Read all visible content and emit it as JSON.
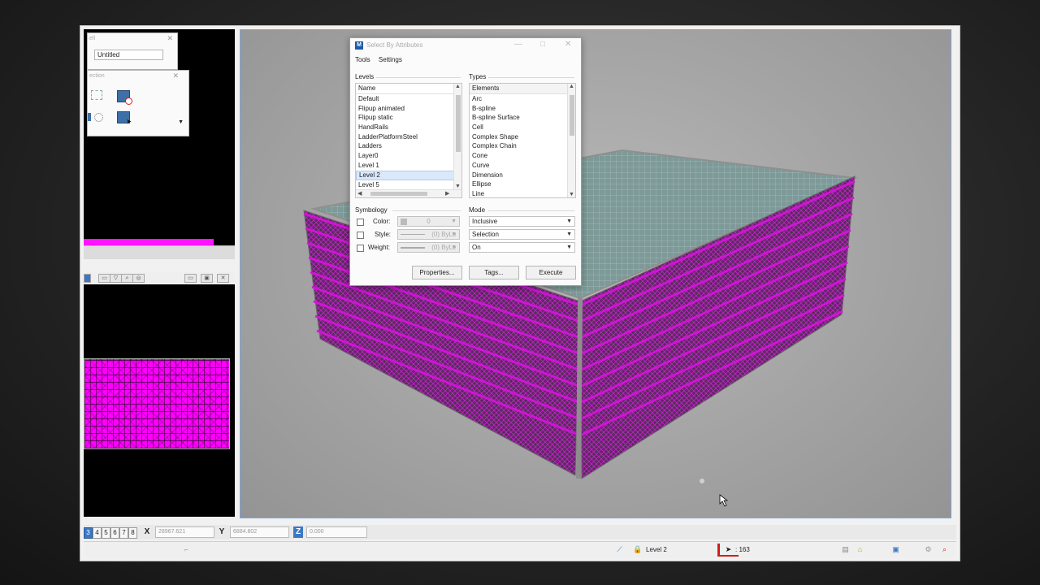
{
  "left_panel": {
    "untitled_value": "Untitled",
    "panel1_partial_title": "ell",
    "panel2_partial_title": "ection"
  },
  "dialog": {
    "title": "Select By Attributes",
    "menu": [
      "Tools",
      "Settings"
    ],
    "levels_group": "Levels",
    "levels_header": "Name",
    "levels": [
      "Default",
      "Flipup animated",
      "Flipup static",
      "HandRails",
      "LadderPlatformSteel",
      "Ladders",
      "Layer0",
      "Level 1",
      "Level 2",
      "Level 5"
    ],
    "levels_selected": "Level 2",
    "types_group": "Types",
    "types_header": "Elements",
    "types": [
      "Arc",
      "B-spline",
      "B-spline Surface",
      "Cell",
      "Complex Shape",
      "Complex Chain",
      "Cone",
      "Curve",
      "Dimension",
      "Ellipse",
      "Line"
    ],
    "symbology_group": "Symbology",
    "color_label": "Color:",
    "color_value": "0",
    "style_label": "Style:",
    "style_value": "(0) ByLe",
    "weight_label": "Weight:",
    "weight_value": "(0) ByLe",
    "mode_group": "Mode",
    "mode_values": [
      "Inclusive",
      "Selection",
      "On"
    ],
    "buttons": {
      "properties": "Properties...",
      "tags": "Tags...",
      "execute": "Execute"
    }
  },
  "coordbar": {
    "view_numbers": [
      "3",
      "4",
      "5",
      "6",
      "7",
      "8"
    ],
    "x_label": "X",
    "x_value": "28967.621",
    "y_label": "Y",
    "y_value": "6884.802",
    "z_label": "Z",
    "z_value": "0.000"
  },
  "statusbar": {
    "active_level": "Level 2",
    "selection_count": ": 163"
  },
  "colors": {
    "magenta": "#ff00ff",
    "accent_blue": "#1c5aa5",
    "viewport_bg": "#a9a9a9"
  }
}
